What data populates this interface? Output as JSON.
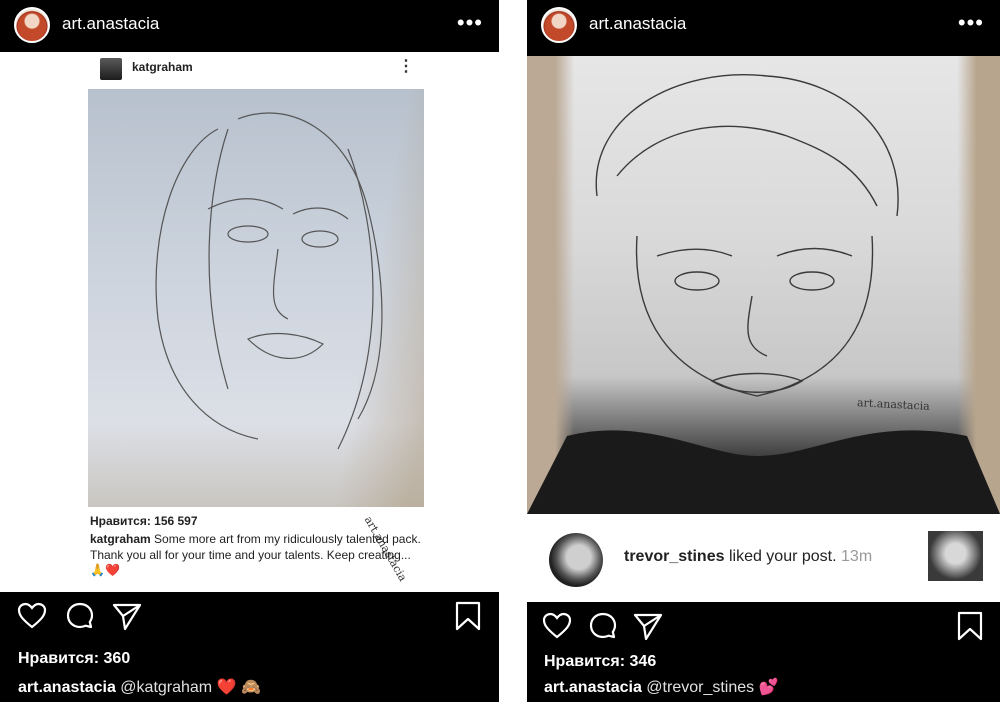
{
  "left_post": {
    "username": "art.anastacia",
    "more_icon": "more-dots-icon",
    "embedded": {
      "username": "katgraham",
      "likes": "Нравится: 156 597",
      "caption_user": "katgraham",
      "caption_text": "Some more art from my ridiculously talented pack. Thank you all for your time and your talents. Keep creating...",
      "emoji": "🙏❤️",
      "signature": "art.anastacia"
    },
    "likes": "Нравится: 360",
    "caption_user": "art.anastacia",
    "caption_text": "@katgraham ❤️ 🙈"
  },
  "right_post": {
    "username": "art.anastacia",
    "more_icon": "more-dots-icon",
    "signature": "art.anastacia",
    "notification": {
      "user": "trevor_stines",
      "text": "liked your post.",
      "time": "13m"
    },
    "likes": "Нравится: 346",
    "caption_user": "art.anastacia",
    "caption_text": "@trevor_stines 💕"
  },
  "icons": [
    "heart-icon",
    "comment-icon",
    "share-icon",
    "bookmark-icon"
  ],
  "colors": {
    "bar_bg": "#000000",
    "text": "#ffffff",
    "heart": "#e0245e"
  }
}
